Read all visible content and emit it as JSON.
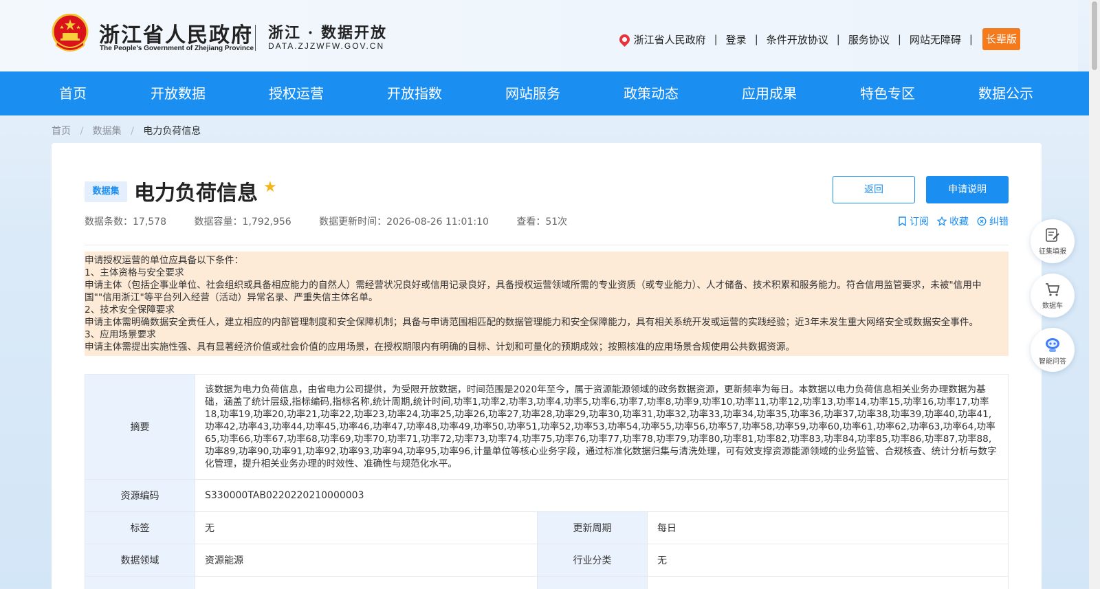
{
  "header": {
    "gov_title": "浙江省人民政府",
    "gov_subtitle": "The People's Government of Zhejiang Province",
    "site_title": "浙江 · 数据开放",
    "site_url": "DATA.ZJZWFW.GOV.CN",
    "links": [
      "浙江省人民政府",
      "登录",
      "条件开放协议",
      "服务协议",
      "网站无障碍"
    ],
    "elder_mode": "长辈版",
    "separator": "|"
  },
  "nav": {
    "items": [
      "首页",
      "开放数据",
      "授权运营",
      "开放指数",
      "网站服务",
      "政策动态",
      "应用成果",
      "特色专区",
      "数据公示"
    ]
  },
  "breadcrumb": {
    "items": [
      "首页",
      "数据集",
      "电力负荷信息"
    ],
    "separator": "/"
  },
  "dataset": {
    "tag": "数据集",
    "title": "电力负荷信息",
    "back_label": "返回",
    "apply_label": "申请说明",
    "meta": {
      "rows": "数据条数：17,578",
      "size": "数据容量：1,792,956",
      "updated": "数据更新时间：2026-08-26 11:01:10",
      "views": "查看：51次"
    },
    "actions": {
      "subscribe": "订阅",
      "favorite": "收藏",
      "correct": "纠错"
    }
  },
  "notice": {
    "lines": [
      "申请授权运营的单位应具备以下条件：",
      "1、主体资格与安全要求",
      "申请主体（包括企事业单位、社会组织或具备相应能力的自然人）需经营状况良好或信用记录良好，具备授权运营领域所需的专业资质（或专业能力）、人才储备、技术积累和服务能力。符合信用监管要求，未被\"信用中国\"\"信用浙江\"等平台列入经营（活动）异常名录、严重失信主体名单。",
      "2、技术安全保障要求",
      "申请主体需明确数据安全责任人，建立相应的内部管理制度和安全保障机制；具备与申请范围相匹配的数据管理能力和安全保障能力，具有相关系统开发或运营的实践经验；近3年未发生重大网络安全或数据安全事件。",
      "3、应用场景要求",
      "申请主体需提出实施性强、具有显著经济价值或社会价值的应用场景，在授权期限内有明确的目标、计划和可量化的预期成效；按照核准的应用场景合规使用公共数据资源。"
    ]
  },
  "info": {
    "summary_label": "摘要",
    "summary": "该数据为电力负荷信息，由省电力公司提供，为受限开放数据，时间范围是2020年至今，属于资源能源领域的政务数据资源，更新频率为每日。本数据以电力负荷信息相关业务办理数据为基础，涵盖了统计层级,指标编码,指标名称,统计周期,统计时间,功率1,功率2,功率3,功率4,功率5,功率6,功率7,功率8,功率9,功率10,功率11,功率12,功率13,功率14,功率15,功率16,功率17,功率18,功率19,功率20,功率21,功率22,功率23,功率24,功率25,功率26,功率27,功率28,功率29,功率30,功率31,功率32,功率33,功率34,功率35,功率36,功率37,功率38,功率39,功率40,功率41,功率42,功率43,功率44,功率45,功率46,功率47,功率48,功率49,功率50,功率51,功率52,功率53,功率54,功率55,功率56,功率57,功率58,功率59,功率60,功率61,功率62,功率63,功率64,功率65,功率66,功率67,功率68,功率69,功率70,功率71,功率72,功率73,功率74,功率75,功率76,功率77,功率78,功率79,功率80,功率81,功率82,功率83,功率84,功率85,功率86,功率87,功率88,功率89,功率90,功率91,功率92,功率93,功率94,功率95,功率96,计量单位等核心业务字段，通过标准化数据归集与清洗处理，可有效支撑资源能源领域的业务监管、合规核查、统计分析与数字化管理，提升相关业务办理的时效性、准确性与规范化水平。",
    "code_label": "资源编码",
    "code": "S330000TAB0220220210000003",
    "tag_label": "标签",
    "tag": "无",
    "cycle_label": "更新周期",
    "cycle": "每日",
    "domain_label": "数据领域",
    "domain": "资源能源",
    "industry_label": "行业分类",
    "industry": "无"
  },
  "float_tools": {
    "collect": "征集填报",
    "cart": "数据车",
    "ai": "智能问答"
  },
  "colors": {
    "primary": "#1b8ef2",
    "star": "#f6b51c",
    "elder": "#f57a1c",
    "notice_bg": "#fdebd8"
  }
}
